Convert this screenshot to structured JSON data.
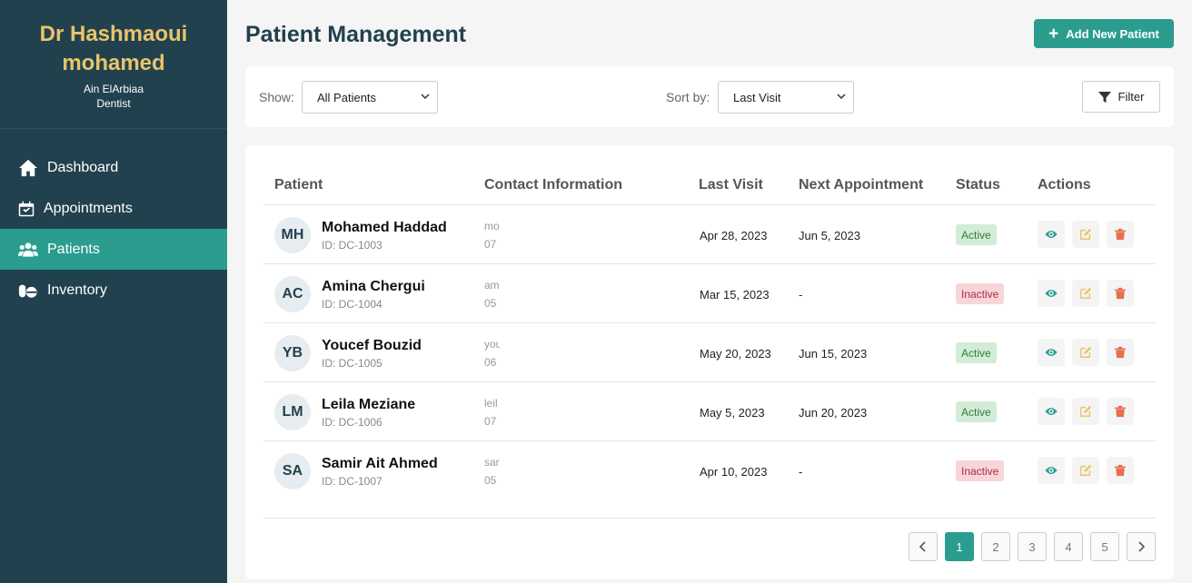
{
  "sidebar": {
    "doctor_name": "Dr Hashmaoui mohamed",
    "location": "Ain ElArbiaa",
    "role": "Dentist",
    "nav": [
      {
        "label": "Dashboard",
        "icon": "home-icon"
      },
      {
        "label": "Appointments",
        "icon": "calendar-icon"
      },
      {
        "label": "Patients",
        "icon": "users-icon",
        "active": true
      },
      {
        "label": "Inventory",
        "icon": "pills-icon"
      }
    ]
  },
  "header": {
    "title": "Patient Management",
    "add_button": "Add New Patient",
    "add_icon": "+"
  },
  "filters": {
    "show_label": "Show:",
    "show_value": "All Patients",
    "sort_label": "Sort by:",
    "sort_value": "Last Visit",
    "filter_button": "Filter"
  },
  "table": {
    "columns": [
      "Patient",
      "Contact Information",
      "Last Visit",
      "Next Appointment",
      "Status",
      "Actions"
    ],
    "rows": [
      {
        "initials": "MH",
        "name": "Mohamed Haddad",
        "id": "ID: DC-1003",
        "contact_line1": "mo",
        "contact_line2": "07",
        "last_visit": "Apr 28, 2023",
        "next_appointment": "Jun 5, 2023",
        "status": "Active"
      },
      {
        "initials": "AC",
        "name": "Amina Chergui",
        "id": "ID: DC-1004",
        "contact_line1": "am",
        "contact_line2": "05",
        "last_visit": "Mar 15, 2023",
        "next_appointment": "-",
        "status": "Inactive"
      },
      {
        "initials": "YB",
        "name": "Youcef Bouzid",
        "id": "ID: DC-1005",
        "contact_line1": "you",
        "contact_line2": "06",
        "last_visit": "May 20, 2023",
        "next_appointment": "Jun 15, 2023",
        "status": "Active"
      },
      {
        "initials": "LM",
        "name": "Leila Meziane",
        "id": "ID: DC-1006",
        "contact_line1": "leil",
        "contact_line2": "07",
        "last_visit": "May 5, 2023",
        "next_appointment": "Jun 20, 2023",
        "status": "Active"
      },
      {
        "initials": "SA",
        "name": "Samir Ait Ahmed",
        "id": "ID: DC-1007",
        "contact_line1": "sar",
        "contact_line2": "05",
        "last_visit": "Apr 10, 2023",
        "next_appointment": "-",
        "status": "Inactive"
      }
    ]
  },
  "pagination": {
    "pages": [
      "1",
      "2",
      "3",
      "4",
      "5"
    ],
    "current": "1"
  },
  "colors": {
    "sidebar_bg": "#22414e",
    "accent": "#2a9d8f",
    "brand_gold": "#e9c46a",
    "edit_yellow": "#e9c46a",
    "delete_red": "#e76f51"
  }
}
